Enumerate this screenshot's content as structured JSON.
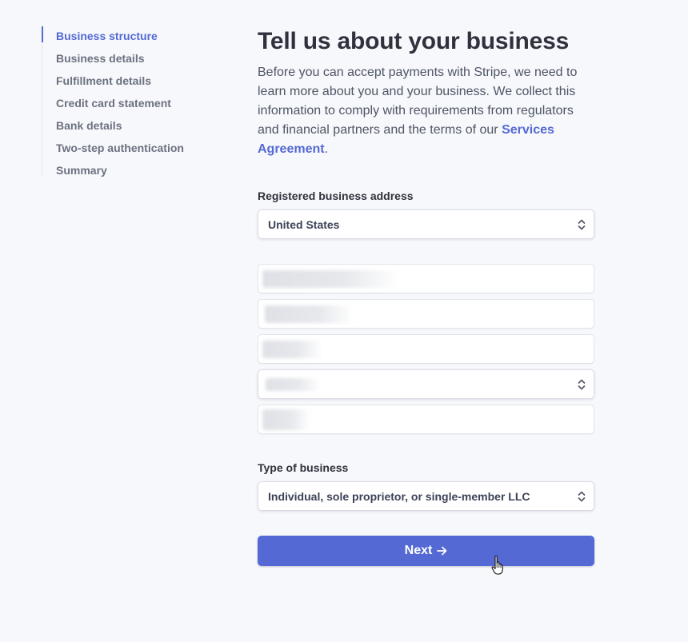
{
  "sidebar": {
    "items": [
      {
        "label": "Business structure",
        "active": true
      },
      {
        "label": "Business details"
      },
      {
        "label": "Fulfillment details"
      },
      {
        "label": "Credit card statement"
      },
      {
        "label": "Bank details"
      },
      {
        "label": "Two-step authentication"
      },
      {
        "label": "Summary"
      }
    ]
  },
  "main": {
    "title": "Tell us about your business",
    "intro_text": "Before you can accept payments with Stripe, we need to learn more about you and your business. We collect this information to comply with requirements from regulators and financial partners and the terms of our ",
    "intro_link": "Services Agreement",
    "intro_end": "."
  },
  "address": {
    "label": "Registered business address",
    "country": "United States"
  },
  "business_type": {
    "label": "Type of business",
    "value": "Individual, sole proprietor, or single-member LLC"
  },
  "actions": {
    "next_label": "Next"
  },
  "colors": {
    "accent": "#5469d4",
    "background": "#f6f8fb",
    "text": "#30313d",
    "muted": "#6c7180"
  },
  "icons": {
    "select_chevron": "chevron-up-down-icon",
    "next_arrow": "arrow-right-icon",
    "pointer": "hand-pointer-cursor-icon"
  }
}
